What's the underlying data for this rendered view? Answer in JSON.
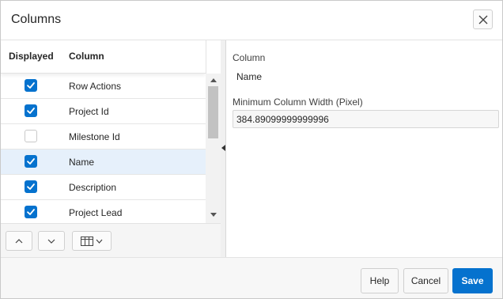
{
  "dialog": {
    "title": "Columns"
  },
  "icons": {
    "close": "close-icon",
    "checkbox": "checkmark-icon",
    "move_up": "chevron-up-icon",
    "move_down": "chevron-down-icon",
    "columns_menu": "table-columns-icon"
  },
  "grid": {
    "headers": {
      "displayed": "Displayed",
      "column": "Column"
    },
    "rows": [
      {
        "name": "Row Actions",
        "displayed": true,
        "selected": false
      },
      {
        "name": "Project Id",
        "displayed": true,
        "selected": false
      },
      {
        "name": "Milestone Id",
        "displayed": false,
        "selected": false
      },
      {
        "name": "Name",
        "displayed": true,
        "selected": true
      },
      {
        "name": "Description",
        "displayed": true,
        "selected": false
      },
      {
        "name": "Project Lead",
        "displayed": true,
        "selected": false
      }
    ]
  },
  "details": {
    "column_label": "Column",
    "column_value": "Name",
    "min_width_label": "Minimum Column Width (Pixel)",
    "min_width_value": "384.89099999999996"
  },
  "footer": {
    "help_label": "Help",
    "cancel_label": "Cancel",
    "save_label": "Save"
  },
  "colors": {
    "accent": "#0572ce",
    "selected_row": "#e6f0fb"
  }
}
